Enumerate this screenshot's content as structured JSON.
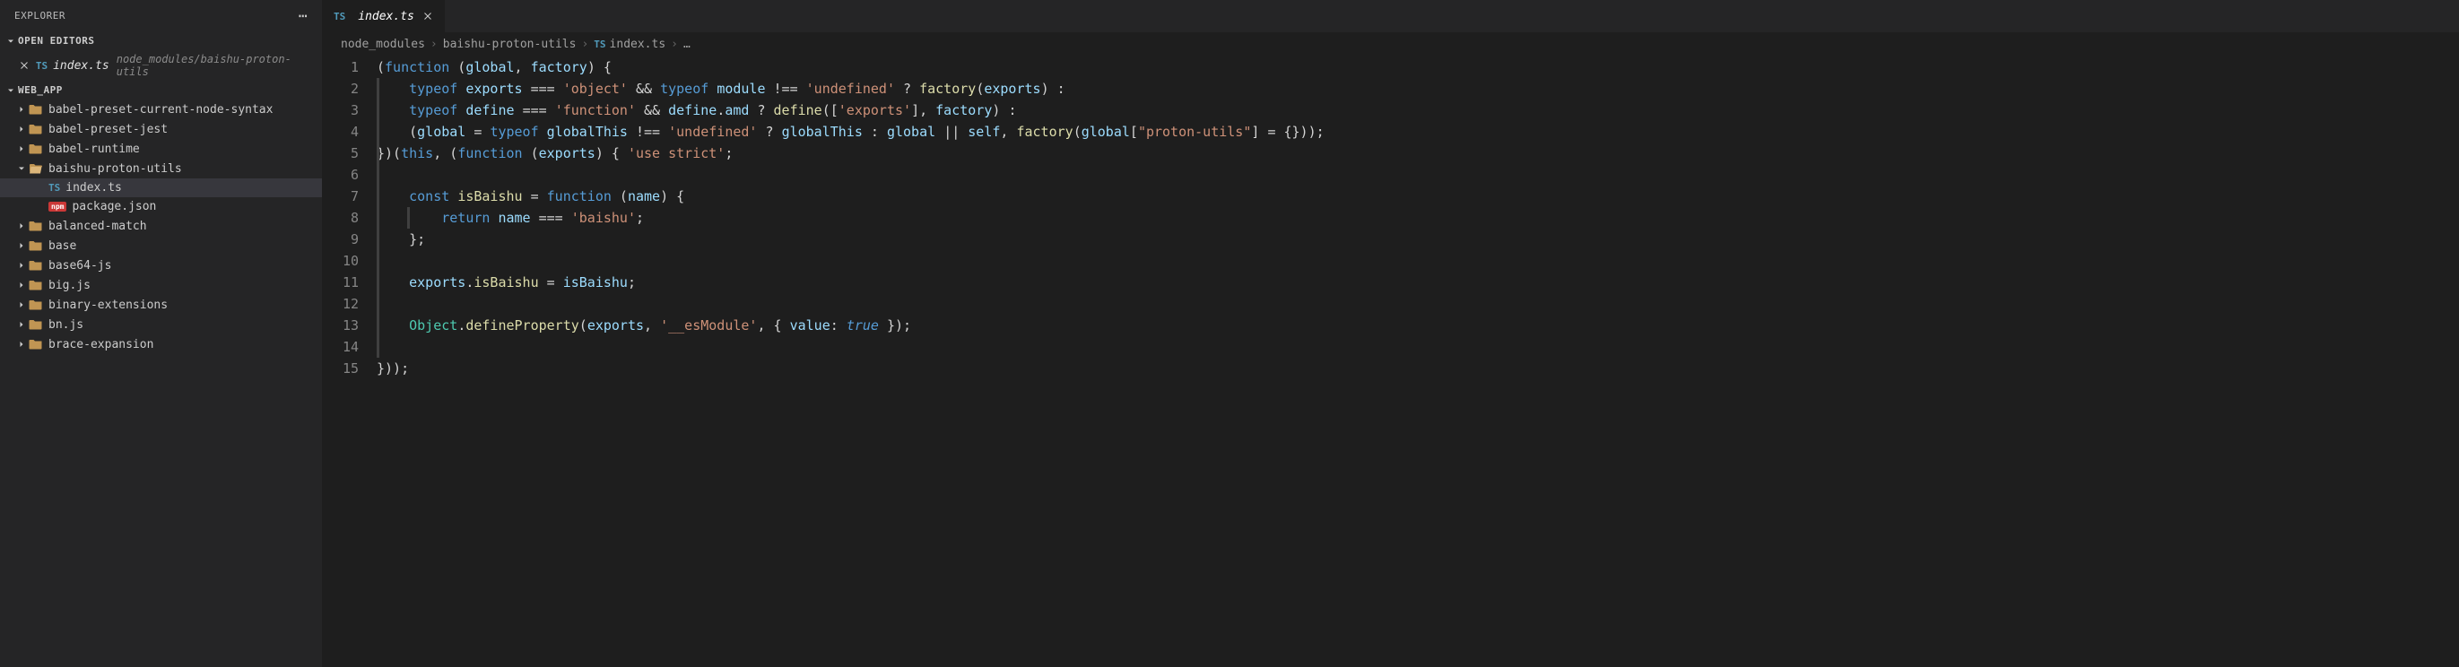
{
  "sidebar": {
    "title": "EXPLORER",
    "sections": {
      "open_editors": {
        "label": "OPEN EDITORS",
        "items": [
          {
            "filename": "index.ts",
            "path": "node_modules/baishu-proton-utils"
          }
        ]
      },
      "workspace": {
        "label": "WEB_APP",
        "tree": [
          {
            "type": "folder",
            "label": "babel-preset-current-node-syntax",
            "expanded": false,
            "indent": 1
          },
          {
            "type": "folder",
            "label": "babel-preset-jest",
            "expanded": false,
            "indent": 1
          },
          {
            "type": "folder",
            "label": "babel-runtime",
            "expanded": false,
            "indent": 1
          },
          {
            "type": "folder",
            "label": "baishu-proton-utils",
            "expanded": true,
            "indent": 1
          },
          {
            "type": "file-ts",
            "label": "index.ts",
            "indent": 2,
            "selected": true
          },
          {
            "type": "file-npm",
            "label": "package.json",
            "indent": 2
          },
          {
            "type": "folder",
            "label": "balanced-match",
            "expanded": false,
            "indent": 1
          },
          {
            "type": "folder",
            "label": "base",
            "expanded": false,
            "indent": 1
          },
          {
            "type": "folder",
            "label": "base64-js",
            "expanded": false,
            "indent": 1
          },
          {
            "type": "folder",
            "label": "big.js",
            "expanded": false,
            "indent": 1
          },
          {
            "type": "folder",
            "label": "binary-extensions",
            "expanded": false,
            "indent": 1
          },
          {
            "type": "folder",
            "label": "bn.js",
            "expanded": false,
            "indent": 1
          },
          {
            "type": "folder",
            "label": "brace-expansion",
            "expanded": false,
            "indent": 1
          }
        ]
      }
    }
  },
  "tabs": [
    {
      "filename": "index.ts",
      "icon": "ts"
    }
  ],
  "breadcrumbs": [
    {
      "label": "node_modules"
    },
    {
      "label": "baishu-proton-utils"
    },
    {
      "label": "index.ts",
      "icon": "ts"
    },
    {
      "label": "…"
    }
  ],
  "code": {
    "lines": [
      {
        "n": 1,
        "indent": 0,
        "tokens": [
          [
            "punc",
            "("
          ],
          [
            "kw",
            "function"
          ],
          [
            "punc",
            " ("
          ],
          [
            "var",
            "global"
          ],
          [
            "punc",
            ", "
          ],
          [
            "var",
            "factory"
          ],
          [
            "punc",
            ") {"
          ]
        ]
      },
      {
        "n": 2,
        "indent": 1,
        "tokens": [
          [
            "kw",
            "typeof"
          ],
          [
            "punc",
            " "
          ],
          [
            "var",
            "exports"
          ],
          [
            "punc",
            " "
          ],
          [
            "op",
            "==="
          ],
          [
            "punc",
            " "
          ],
          [
            "str",
            "'object'"
          ],
          [
            "punc",
            " "
          ],
          [
            "op",
            "&&"
          ],
          [
            "punc",
            " "
          ],
          [
            "kw",
            "typeof"
          ],
          [
            "punc",
            " "
          ],
          [
            "var",
            "module"
          ],
          [
            "punc",
            " "
          ],
          [
            "op",
            "!=="
          ],
          [
            "punc",
            " "
          ],
          [
            "str",
            "'undefined'"
          ],
          [
            "punc",
            " "
          ],
          [
            "op",
            "?"
          ],
          [
            "punc",
            " "
          ],
          [
            "fn",
            "factory"
          ],
          [
            "punc",
            "("
          ],
          [
            "var",
            "exports"
          ],
          [
            "punc",
            ") "
          ],
          [
            "op",
            ":"
          ]
        ]
      },
      {
        "n": 3,
        "indent": 1,
        "tokens": [
          [
            "kw",
            "typeof"
          ],
          [
            "punc",
            " "
          ],
          [
            "var",
            "define"
          ],
          [
            "punc",
            " "
          ],
          [
            "op",
            "==="
          ],
          [
            "punc",
            " "
          ],
          [
            "str",
            "'function'"
          ],
          [
            "punc",
            " "
          ],
          [
            "op",
            "&&"
          ],
          [
            "punc",
            " "
          ],
          [
            "var",
            "define"
          ],
          [
            "punc",
            "."
          ],
          [
            "prop",
            "amd"
          ],
          [
            "punc",
            " "
          ],
          [
            "op",
            "?"
          ],
          [
            "punc",
            " "
          ],
          [
            "fn",
            "define"
          ],
          [
            "punc",
            "(["
          ],
          [
            "str",
            "'exports'"
          ],
          [
            "punc",
            "], "
          ],
          [
            "var",
            "factory"
          ],
          [
            "punc",
            ") "
          ],
          [
            "op",
            ":"
          ]
        ]
      },
      {
        "n": 4,
        "indent": 1,
        "tokens": [
          [
            "punc",
            "("
          ],
          [
            "var",
            "global"
          ],
          [
            "punc",
            " "
          ],
          [
            "op",
            "="
          ],
          [
            "punc",
            " "
          ],
          [
            "kw",
            "typeof"
          ],
          [
            "punc",
            " "
          ],
          [
            "var",
            "globalThis"
          ],
          [
            "punc",
            " "
          ],
          [
            "op",
            "!=="
          ],
          [
            "punc",
            " "
          ],
          [
            "str",
            "'undefined'"
          ],
          [
            "punc",
            " "
          ],
          [
            "op",
            "?"
          ],
          [
            "punc",
            " "
          ],
          [
            "var",
            "globalThis"
          ],
          [
            "punc",
            " "
          ],
          [
            "op",
            ":"
          ],
          [
            "punc",
            " "
          ],
          [
            "var",
            "global"
          ],
          [
            "punc",
            " "
          ],
          [
            "op",
            "||"
          ],
          [
            "punc",
            " "
          ],
          [
            "var",
            "self"
          ],
          [
            "punc",
            ", "
          ],
          [
            "fn",
            "factory"
          ],
          [
            "punc",
            "("
          ],
          [
            "var",
            "global"
          ],
          [
            "punc",
            "["
          ],
          [
            "str",
            "\"proton-utils\""
          ],
          [
            "punc",
            "] "
          ],
          [
            "op",
            "="
          ],
          [
            "punc",
            " {}));"
          ]
        ]
      },
      {
        "n": 5,
        "indent": 0,
        "tokens": [
          [
            "punc",
            "})("
          ],
          [
            "kw",
            "this"
          ],
          [
            "punc",
            ", ("
          ],
          [
            "kw",
            "function"
          ],
          [
            "punc",
            " ("
          ],
          [
            "var",
            "exports"
          ],
          [
            "punc",
            ") { "
          ],
          [
            "str",
            "'use strict'"
          ],
          [
            "punc",
            ";"
          ]
        ]
      },
      {
        "n": 6,
        "indent": 0,
        "tokens": []
      },
      {
        "n": 7,
        "indent": 1,
        "tokens": [
          [
            "kw",
            "const"
          ],
          [
            "punc",
            " "
          ],
          [
            "fn",
            "isBaishu"
          ],
          [
            "punc",
            " "
          ],
          [
            "op",
            "="
          ],
          [
            "punc",
            " "
          ],
          [
            "kw",
            "function"
          ],
          [
            "punc",
            " ("
          ],
          [
            "var",
            "name"
          ],
          [
            "punc",
            ") {"
          ]
        ]
      },
      {
        "n": 8,
        "indent": 2,
        "tokens": [
          [
            "kw",
            "return"
          ],
          [
            "punc",
            " "
          ],
          [
            "var",
            "name"
          ],
          [
            "punc",
            " "
          ],
          [
            "op",
            "==="
          ],
          [
            "punc",
            " "
          ],
          [
            "str",
            "'baishu'"
          ],
          [
            "punc",
            ";"
          ]
        ]
      },
      {
        "n": 9,
        "indent": 1,
        "tokens": [
          [
            "punc",
            "};"
          ]
        ]
      },
      {
        "n": 10,
        "indent": 0,
        "tokens": []
      },
      {
        "n": 11,
        "indent": 1,
        "tokens": [
          [
            "var",
            "exports"
          ],
          [
            "punc",
            "."
          ],
          [
            "fn",
            "isBaishu"
          ],
          [
            "punc",
            " "
          ],
          [
            "op",
            "="
          ],
          [
            "punc",
            " "
          ],
          [
            "var",
            "isBaishu"
          ],
          [
            "punc",
            ";"
          ]
        ]
      },
      {
        "n": 12,
        "indent": 0,
        "tokens": []
      },
      {
        "n": 13,
        "indent": 1,
        "tokens": [
          [
            "type",
            "Object"
          ],
          [
            "punc",
            "."
          ],
          [
            "fn",
            "defineProperty"
          ],
          [
            "punc",
            "("
          ],
          [
            "var",
            "exports"
          ],
          [
            "punc",
            ", "
          ],
          [
            "str",
            "'__esModule'"
          ],
          [
            "punc",
            ", { "
          ],
          [
            "prop",
            "value"
          ],
          [
            "punc",
            ": "
          ],
          [
            "const",
            "true"
          ],
          [
            "punc",
            " });"
          ]
        ]
      },
      {
        "n": 14,
        "indent": 0,
        "tokens": []
      },
      {
        "n": 15,
        "indent": 0,
        "tokens": [
          [
            "punc",
            "}));"
          ]
        ]
      }
    ]
  }
}
